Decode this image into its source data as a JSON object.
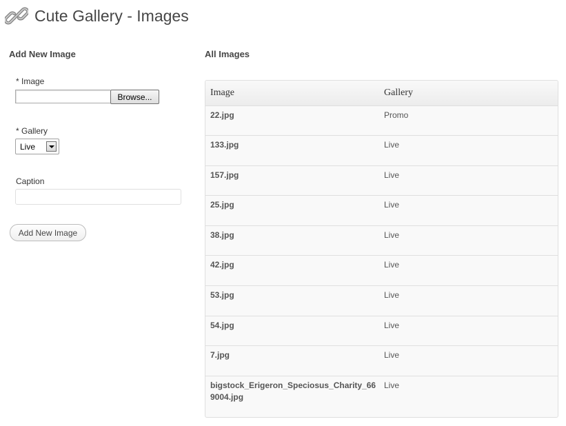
{
  "page": {
    "title": "Cute Gallery - Images",
    "icon": "chain-link-icon"
  },
  "add_form": {
    "heading": "Add New Image",
    "image_label": "* Image",
    "browse_label": "Browse...",
    "gallery_label": "* Gallery",
    "gallery_selected": "Live",
    "caption_label": "Caption",
    "caption_value": "",
    "submit_label": "Add New Image"
  },
  "images_table": {
    "heading": "All Images",
    "columns": [
      "Image",
      "Gallery"
    ],
    "rows": [
      {
        "image": "22.jpg",
        "gallery": "Promo"
      },
      {
        "image": "133.jpg",
        "gallery": "Live"
      },
      {
        "image": "157.jpg",
        "gallery": "Live"
      },
      {
        "image": "25.jpg",
        "gallery": "Live"
      },
      {
        "image": "38.jpg",
        "gallery": "Live"
      },
      {
        "image": "42.jpg",
        "gallery": "Live"
      },
      {
        "image": "53.jpg",
        "gallery": "Live"
      },
      {
        "image": "54.jpg",
        "gallery": "Live"
      },
      {
        "image": "7.jpg",
        "gallery": "Live"
      },
      {
        "image": "bigstock_Erigeron_Speciosus_Charity_669004.jpg",
        "gallery": "Live"
      }
    ]
  }
}
